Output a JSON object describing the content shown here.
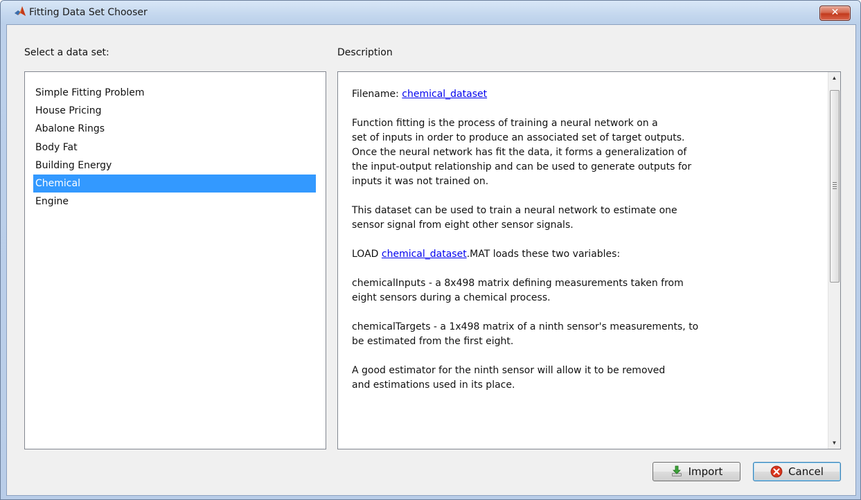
{
  "window": {
    "title": "Fitting Data Set Chooser",
    "close_label": "✕",
    "accent_color": "#3399ff"
  },
  "list_panel": {
    "label": "Select a data set:",
    "items": [
      {
        "label": "Simple Fitting Problem",
        "selected": false
      },
      {
        "label": "House Pricing",
        "selected": false
      },
      {
        "label": "Abalone Rings",
        "selected": false
      },
      {
        "label": "Body Fat",
        "selected": false
      },
      {
        "label": "Building Energy",
        "selected": false
      },
      {
        "label": "Chemical",
        "selected": true
      },
      {
        "label": "Engine",
        "selected": false
      }
    ]
  },
  "description_panel": {
    "label": "Description",
    "filename_prefix": "Filename: ",
    "filename_link": "chemical_dataset",
    "paragraph_1": "Function fitting is the process of training a neural network on a\nset of inputs in order to produce an associated set of target outputs.\nOnce the neural network has fit the data, it forms a generalization of\nthe input-output relationship and can be used to generate outputs for\ninputs it was not trained on.",
    "paragraph_2": "This dataset can be used to train a neural network to estimate one\nsensor signal from eight other sensor signals.",
    "load_prefix": "LOAD ",
    "load_link": "chemical_dataset",
    "load_suffix": ".MAT loads these two variables:",
    "paragraph_3": "chemicalInputs - a 8x498 matrix defining measurements taken from\neight sensors during a chemical process.",
    "paragraph_4": "chemicalTargets - a 1x498 matrix of a ninth sensor's measurements, to\nbe estimated from the first eight.",
    "paragraph_5": "A good estimator for the ninth sensor will allow it to be removed\nand estimations used in its place.",
    "icons": [
      "scroll-up-arrow-icon",
      "scroll-down-arrow-icon",
      "scroll-grip-icon"
    ]
  },
  "buttons": {
    "import_label": "Import",
    "cancel_label": "Cancel",
    "import_icon": "import-arrow-icon",
    "cancel_icon": "cancel-x-icon"
  }
}
